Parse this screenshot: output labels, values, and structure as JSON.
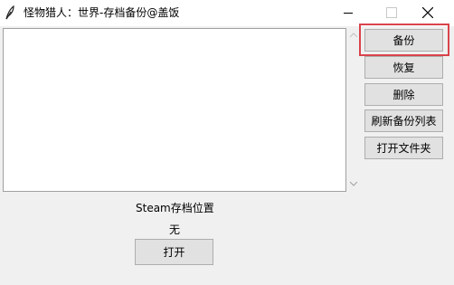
{
  "window": {
    "title": "怪物猎人：世界-存档备份@盖饭",
    "icon": "feather-icon",
    "controls": [
      "minimize-icon",
      "maximize-icon",
      "close-icon"
    ]
  },
  "backup_list": {
    "items": []
  },
  "buttons": {
    "backup": "备份",
    "restore": "恢复",
    "delete": "删除",
    "refresh": "刷新备份列表",
    "open_folder": "打开文件夹"
  },
  "steam": {
    "label": "Steam存档位置",
    "path": "无",
    "open_button": "打开"
  },
  "colors": {
    "highlight": "#d9434b",
    "button_face": "#e1e1e1",
    "window_bg": "#f0f0f0"
  }
}
